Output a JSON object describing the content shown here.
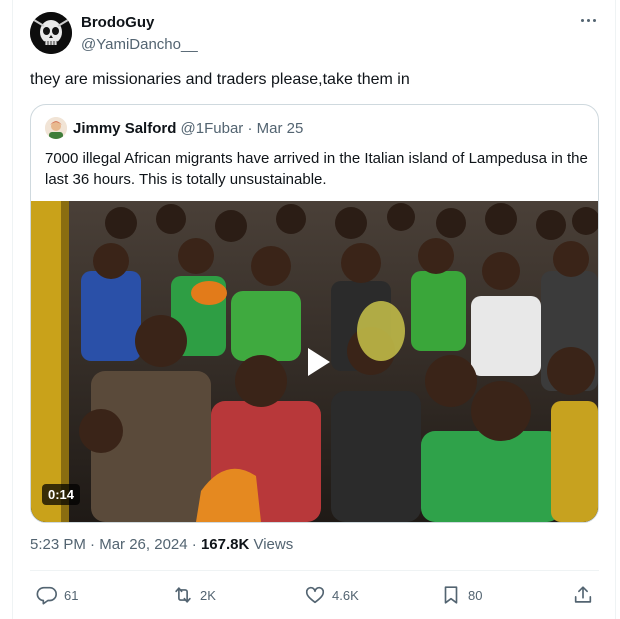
{
  "author": {
    "display_name": "BrodoGuy",
    "handle": "@YamiDancho__"
  },
  "tweet": {
    "text": "they are missionaries and traders please,take them in"
  },
  "quoted_tweet": {
    "display_name": "Jimmy Salford",
    "handle": "@1Fubar",
    "separator": " · ",
    "date": "Mar 25",
    "text": "7000 illegal African migrants have arrived in the Italian island of Lampedusa in the last 36 hours. This is totally unsustainable.",
    "video": {
      "duration": "0:14"
    }
  },
  "meta": {
    "time": "5:23 PM",
    "separator": " · ",
    "date": "Mar 26, 2024",
    "dot": " · ",
    "views_count": "167.8K",
    "views_label": " Views"
  },
  "actions": {
    "replies": "61",
    "reposts": "2K",
    "likes": "4.6K",
    "bookmarks": "80"
  },
  "icons": [
    "more-icon",
    "play-icon",
    "reply-icon",
    "repost-icon",
    "like-icon",
    "bookmark-icon",
    "share-icon"
  ],
  "colors": {
    "text_primary": "#0f1419",
    "text_secondary": "#536471",
    "border": "#cfd9de",
    "divider": "#eff3f4"
  }
}
